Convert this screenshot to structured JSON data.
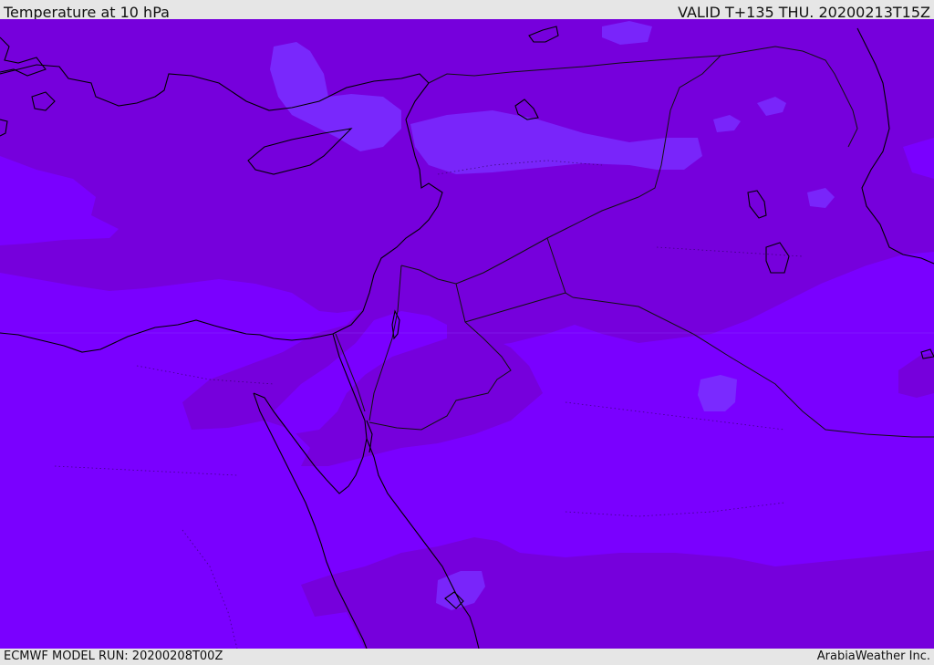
{
  "header": {
    "title": "Temperature at 10 hPa",
    "valid": "VALID T+135 THU. 20200213T15Z"
  },
  "footer": {
    "model_run": "ECMWF MODEL RUN: 20200208T00Z",
    "credit": "ArabiaWeather Inc."
  },
  "colors": {
    "background": "#7a00ff",
    "darker_band": "#7700dd",
    "lighter_patch": "#7a2cff",
    "coastline": "#000000",
    "border": "#111111",
    "bar": "#e6e6e6"
  }
}
